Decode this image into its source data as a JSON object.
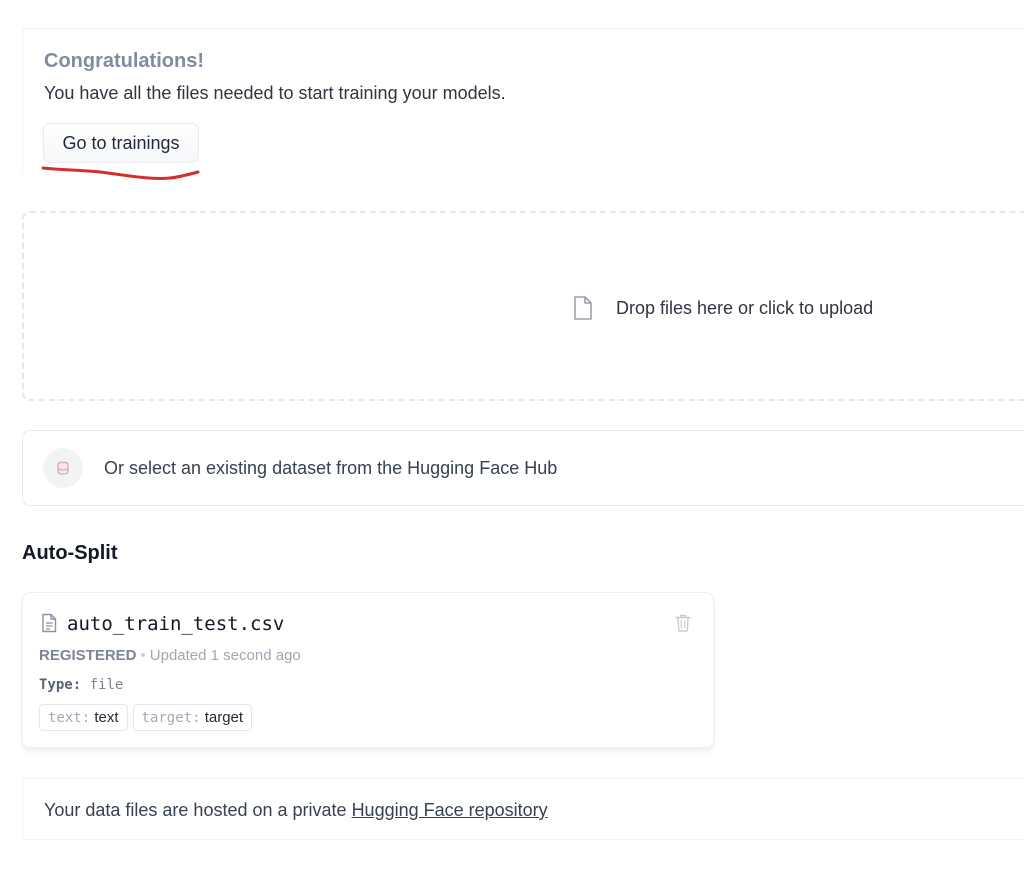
{
  "congrats": {
    "title": "Congratulations!",
    "message": "You have all the files needed to start training your models.",
    "button_label": "Go to trainings",
    "annotation_color": "#d32f2f"
  },
  "upload": {
    "icon": "file-icon",
    "label": "Drop files here or click to upload"
  },
  "hub": {
    "icon": "dataset-icon",
    "label": "Or select an existing dataset from the Hugging Face Hub"
  },
  "auto_split": {
    "title": "Auto-Split",
    "file": {
      "icon": "document-icon",
      "name": "auto_train_test.csv",
      "status": "REGISTERED",
      "separator": "•",
      "updated": "Updated 1 second ago",
      "type_key": "Type:",
      "type_value": "file",
      "delete_icon": "trash-icon",
      "mappings": [
        {
          "key": "text:",
          "value": "text"
        },
        {
          "key": "target:",
          "value": "target"
        }
      ]
    }
  },
  "footer": {
    "text": "Your data files are hosted on a private",
    "link_label": "Hugging Face repository"
  }
}
